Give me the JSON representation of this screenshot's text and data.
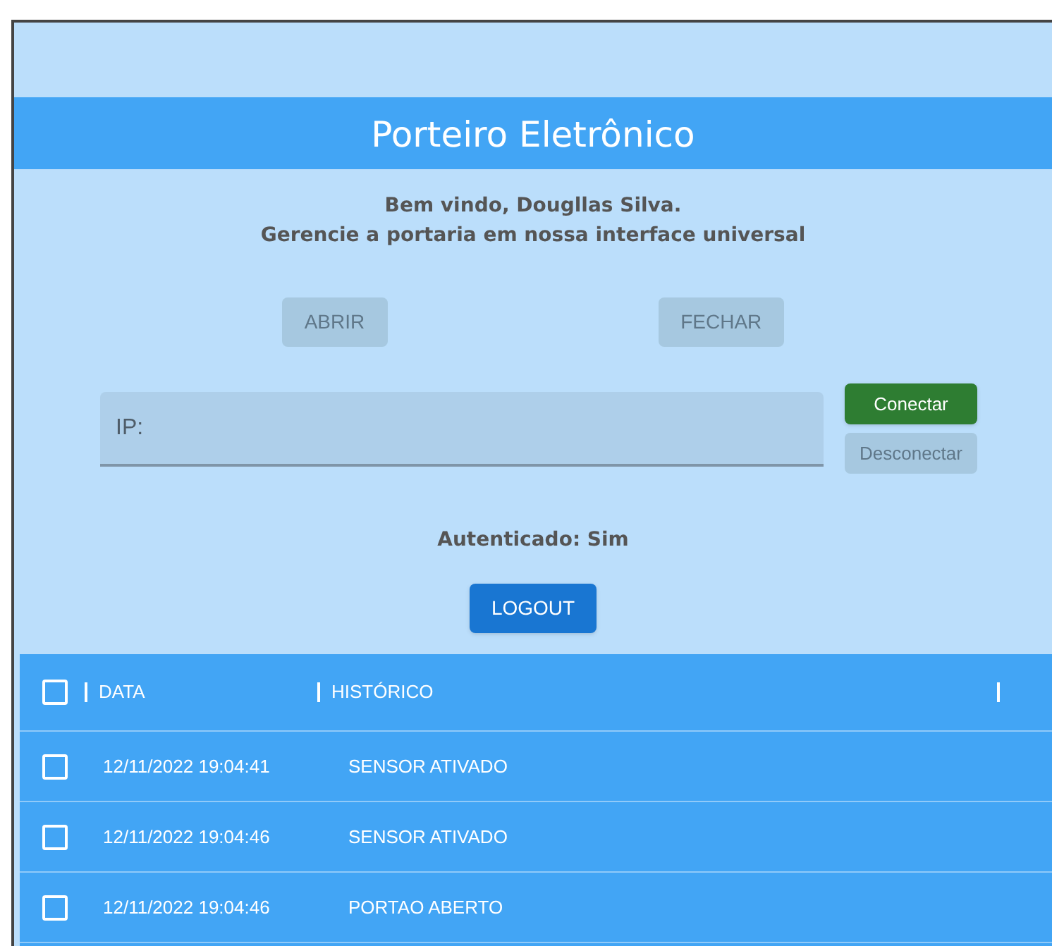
{
  "header": {
    "title": "Porteiro Eletrônico"
  },
  "welcome": [
    "Bem vindo, Dougllas Silva.",
    "Gerencie a portaria em nossa interface universal"
  ],
  "gate_buttons": [
    {
      "label": "ABRIR",
      "disabled": true
    },
    {
      "label": "FECHAR",
      "disabled": true
    }
  ],
  "ip_field": {
    "placeholder": "IP:"
  },
  "connection_buttons": [
    {
      "label": "Conectar",
      "disabled": false
    },
    {
      "label": "Desconectar",
      "disabled": true
    }
  ],
  "auth_status": "Autenticado: Sim",
  "logout_button": {
    "label": "LOGOUT"
  },
  "table": {
    "select_all_checked": false,
    "columns": [
      "DATA",
      "HISTÓRICO"
    ],
    "rows": [
      {
        "checked": false,
        "date": "12/11/2022 19:04:41",
        "event": "SENSOR ATIVADO"
      },
      {
        "checked": false,
        "date": "12/11/2022 19:04:46",
        "event": "SENSOR ATIVADO"
      },
      {
        "checked": false,
        "date": "12/11/2022 19:04:46",
        "event": "PORTAO ABERTO"
      }
    ]
  }
}
